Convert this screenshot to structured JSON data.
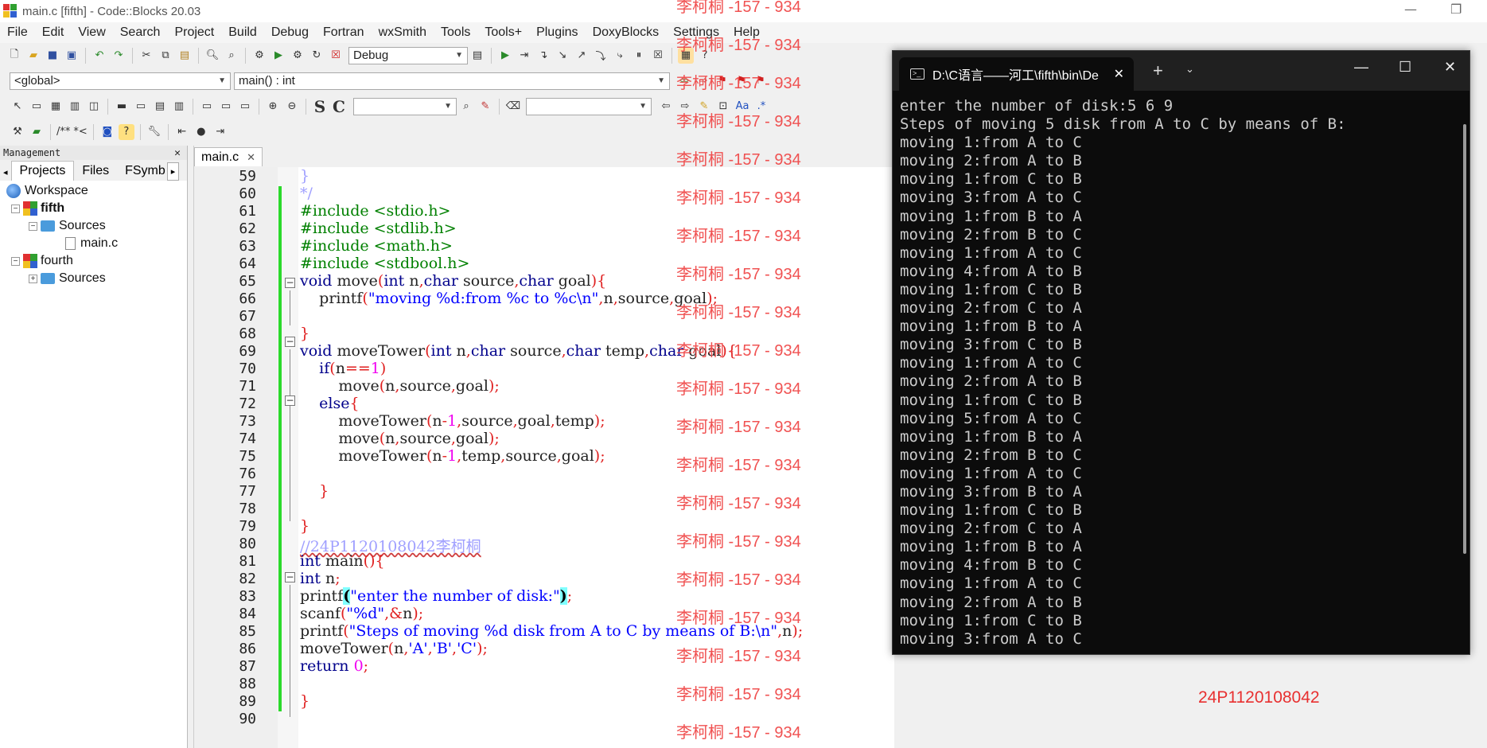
{
  "window": {
    "title": "main.c [fifth] - Code::Blocks 20.03"
  },
  "menu": [
    "File",
    "Edit",
    "View",
    "Search",
    "Project",
    "Build",
    "Debug",
    "Fortran",
    "wxSmith",
    "Tools",
    "Tools+",
    "Plugins",
    "DoxyBlocks",
    "Settings",
    "Help"
  ],
  "toolbar": {
    "build_target": "Debug",
    "scope": "<global>",
    "symbol": "main() : int"
  },
  "management": {
    "title": "Management",
    "tabs": [
      "Projects",
      "Files",
      "FSymb"
    ],
    "tree": {
      "workspace": "Workspace",
      "project1": "fifth",
      "sources": "Sources",
      "file": "main.c",
      "project2": "fourth",
      "sources2": "Sources"
    }
  },
  "editor": {
    "tab": "main.c",
    "line_numbers": [
      "59",
      "60",
      "61",
      "62",
      "63",
      "64",
      "65",
      "66",
      "67",
      "68",
      "69",
      "70",
      "71",
      "72",
      "73",
      "74",
      "75",
      "76",
      "77",
      "78",
      "79",
      "80",
      "81",
      "82",
      "83",
      "84",
      "85",
      "86",
      "87",
      "88",
      "89",
      "90"
    ]
  },
  "watermark": {
    "text": "李柯桐 -157 - 934",
    "student_id": "24P1120108042"
  },
  "terminal": {
    "tab_title": "D:\\C语言——河工\\fifth\\bin\\De",
    "lines": [
      "enter the number of disk:5 6 9",
      "Steps of moving 5 disk from A to C by means of B:",
      "moving 1:from A to C",
      "moving 2:from A to B",
      "moving 1:from C to B",
      "moving 3:from A to C",
      "moving 1:from B to A",
      "moving 2:from B to C",
      "moving 1:from A to C",
      "moving 4:from A to B",
      "moving 1:from C to B",
      "moving 2:from C to A",
      "moving 1:from B to A",
      "moving 3:from C to B",
      "moving 1:from A to C",
      "moving 2:from A to B",
      "moving 1:from C to B",
      "moving 5:from A to C",
      "moving 1:from B to A",
      "moving 2:from B to C",
      "moving 1:from A to C",
      "moving 3:from B to A",
      "moving 1:from C to B",
      "moving 2:from C to A",
      "moving 1:from B to A",
      "moving 4:from B to C",
      "moving 1:from A to C",
      "moving 2:from A to B",
      "moving 1:from C to B",
      "moving 3:from A to C"
    ]
  }
}
